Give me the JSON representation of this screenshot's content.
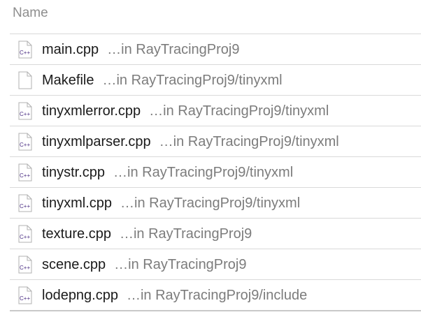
{
  "header": {
    "name_label": "Name"
  },
  "files": [
    {
      "name": "main.cpp",
      "location": "…in RayTracingProj9",
      "icon": "cpp-file-icon"
    },
    {
      "name": "Makefile",
      "location": "…in RayTracingProj9/tinyxml",
      "icon": "plain-file-icon"
    },
    {
      "name": "tinyxmlerror.cpp",
      "location": "…in RayTracingProj9/tinyxml",
      "icon": "cpp-file-icon"
    },
    {
      "name": "tinyxmlparser.cpp",
      "location": "…in RayTracingProj9/tinyxml",
      "icon": "cpp-file-icon"
    },
    {
      "name": "tinystr.cpp",
      "location": "…in RayTracingProj9/tinyxml",
      "icon": "cpp-file-icon"
    },
    {
      "name": "tinyxml.cpp",
      "location": "…in RayTracingProj9/tinyxml",
      "icon": "cpp-file-icon"
    },
    {
      "name": "texture.cpp",
      "location": "…in RayTracingProj9",
      "icon": "cpp-file-icon"
    },
    {
      "name": "scene.cpp",
      "location": "…in RayTracingProj9",
      "icon": "cpp-file-icon"
    },
    {
      "name": "lodepng.cpp",
      "location": "…in RayTracingProj9/include",
      "icon": "cpp-file-icon"
    }
  ],
  "icon_badge_text": "C++",
  "colors": {
    "cpp_badge": "#4b2e83",
    "separator": "#d9d9d9",
    "secondary_text": "#7c7c7c"
  }
}
